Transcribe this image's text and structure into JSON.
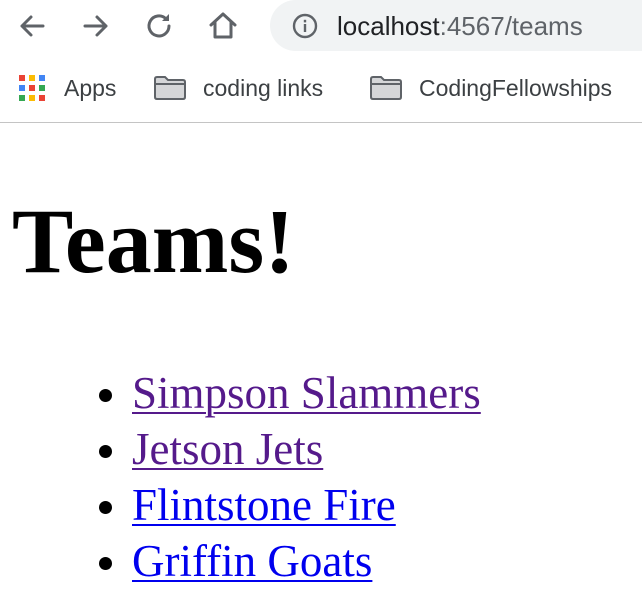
{
  "browser": {
    "url_host": "localhost",
    "url_rest": ":4567/teams"
  },
  "bookmarks": {
    "items": [
      {
        "label": "Apps"
      },
      {
        "label": "coding links"
      },
      {
        "label": "CodingFellowships"
      }
    ]
  },
  "page": {
    "title": "Teams!",
    "teams": [
      {
        "name": "Simpson Slammers",
        "visited": true
      },
      {
        "name": "Jetson Jets",
        "visited": true
      },
      {
        "name": "Flintstone Fire",
        "visited": false
      },
      {
        "name": "Griffin Goats",
        "visited": false
      }
    ]
  },
  "icons": {
    "back": "back-arrow-icon",
    "forward": "forward-arrow-icon",
    "reload": "reload-icon",
    "home": "home-icon",
    "site_info": "info-icon",
    "apps": "apps-grid-icon",
    "bookmark_folder": "folder-icon"
  },
  "colors": {
    "visited_link": "#551a8b",
    "unvisited_link": "#0000ee",
    "omnibox_bg": "#f1f3f4",
    "icon": "#5f6368"
  }
}
